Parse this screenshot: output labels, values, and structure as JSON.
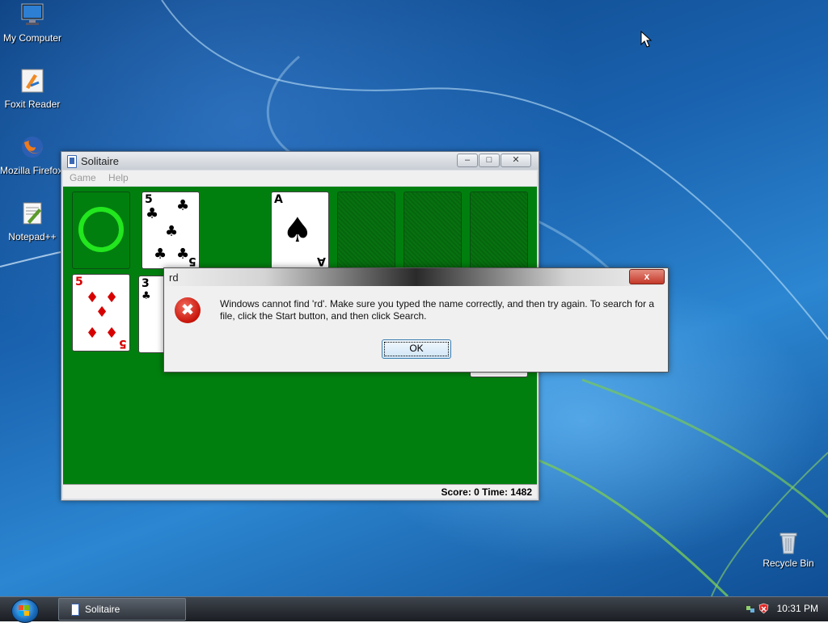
{
  "desktop": {
    "icons": [
      {
        "label": "My Computer",
        "icon": "monitor-icon"
      },
      {
        "label": "Foxit Reader",
        "icon": "foxit-reader-icon"
      },
      {
        "label": "Mozilla Firefox",
        "icon": "firefox-icon"
      },
      {
        "label": "Notepad++",
        "icon": "notepad-plus-plus-icon"
      }
    ],
    "recycle_bin": {
      "label": "Recycle Bin",
      "icon": "recycle-bin-icon"
    }
  },
  "solitaire": {
    "title": "Solitaire",
    "menu": [
      "Game",
      "Help"
    ],
    "status": "Score: 0 Time: 1482",
    "cards": {
      "stock_top": {
        "rank": "5",
        "suit": "♣"
      },
      "foundation_1": {
        "rank": "A",
        "suit": "♠"
      },
      "tableau_1": {
        "rank": "5",
        "suit": "♦"
      },
      "tableau_2": {
        "rank": "3",
        "suit": "♣"
      }
    },
    "felt_color": "#007f0e"
  },
  "dialog": {
    "title": "rd",
    "message": "Windows cannot find 'rd'. Make sure you typed the name correctly, and then try again. To search for a file, click the Start button, and then click Search.",
    "ok_label": "OK",
    "close_label": "x",
    "icon": "error-icon"
  },
  "taskbar": {
    "task": "Solitaire",
    "clock": "10:31 PM"
  }
}
